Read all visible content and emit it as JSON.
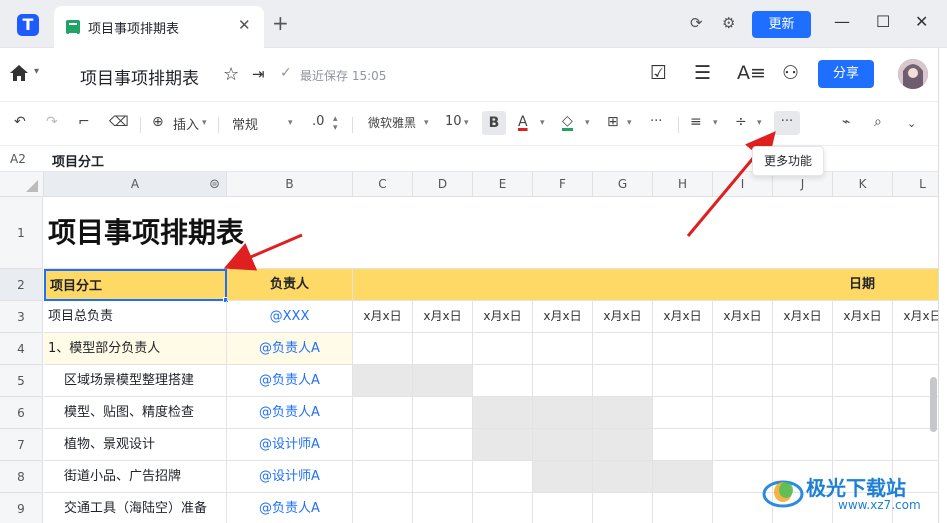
{
  "titlebar": {
    "tab_title": "项目事项排期表",
    "tab_close": "✕",
    "tab_add": "+",
    "update_label": "更新",
    "minimize": "—",
    "maximize": "☐",
    "close": "✕"
  },
  "docbar": {
    "title": "项目事项排期表",
    "save_status": "最近保存 15:05",
    "share_label": "分享"
  },
  "toolbar": {
    "insert_label": "插入",
    "format_label": "常规",
    "decimal_label": ".0",
    "font_label": "微软雅黑",
    "size_label": "10",
    "bold_label": "B",
    "text_color_label": "A",
    "more_label": "···"
  },
  "tooltip": "更多功能",
  "formula": {
    "cell_ref": "A2",
    "value": "项目分工"
  },
  "columns": [
    "A",
    "B",
    "C",
    "D",
    "E",
    "F",
    "G",
    "H",
    "I",
    "J",
    "K",
    "L"
  ],
  "rows": [
    "1",
    "2",
    "3",
    "4",
    "5",
    "6",
    "7",
    "8",
    "9"
  ],
  "sheet": {
    "title": "项目事项排期表",
    "header_a": "项目分工",
    "header_b": "负责人",
    "header_date": "日期",
    "date_cell": "x月x日",
    "items": [
      {
        "task": "项目总负责",
        "owner": "@XXX"
      },
      {
        "task": "1、模型部分负责人",
        "owner": "@负责人A"
      },
      {
        "task": "区域场景模型整理搭建",
        "owner": "@负责人A"
      },
      {
        "task": "模型、贴图、精度检查",
        "owner": "@负责人A"
      },
      {
        "task": "植物、景观设计",
        "owner": "@设计师A"
      },
      {
        "task": "街道小品、广告招牌",
        "owner": "@设计师A"
      },
      {
        "task": "交通工具（海陆空）准备",
        "owner": "@负责人A"
      }
    ]
  },
  "watermark": {
    "brand": "极光下载站",
    "url": "www.xz7.com"
  },
  "colors": {
    "accent": "#1e6fff",
    "header_fill": "#ffd966",
    "grey_fill": "#e8e8e8",
    "arrow": "#e02020"
  }
}
